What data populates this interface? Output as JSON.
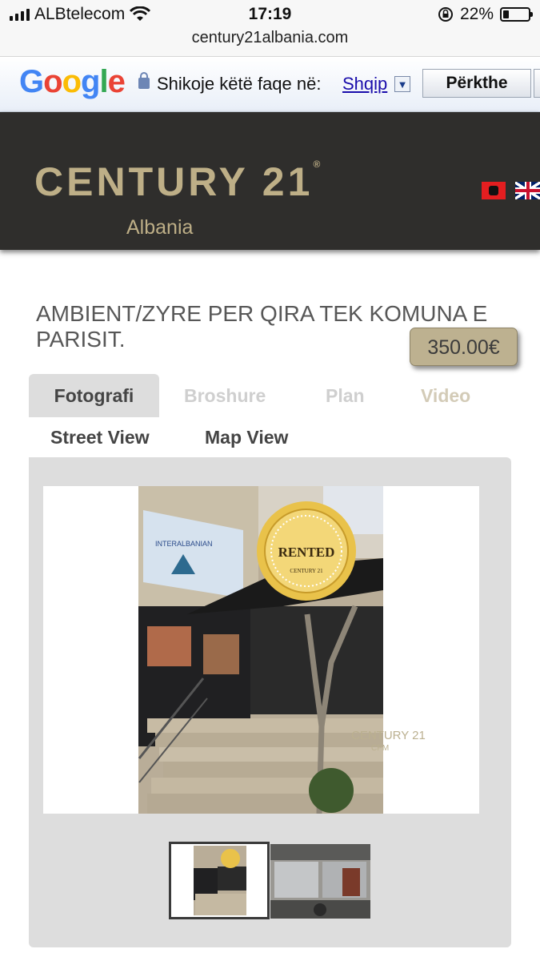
{
  "status_bar": {
    "carrier": "ALBtelecom",
    "time": "17:19",
    "battery": "22%",
    "battery_level": 0.22,
    "url": "century21albania.com"
  },
  "google_translate": {
    "logo": "Google",
    "prompt": "Shikoje këtë faqe në:",
    "language": "Shqip",
    "dropdown_glyph": "▼",
    "translate_button": "Përkthe"
  },
  "header": {
    "brand": "CENTURY 21",
    "brand_mark": "®",
    "subtitle": "Albania",
    "color": "#beaf87",
    "flags": [
      "albania-flag",
      "uk-flag"
    ]
  },
  "listing": {
    "title": "AMBIENT/ZYRE PER QIRA TEK KOMUNA E PARISIT.",
    "price": "350.00€"
  },
  "tabs": {
    "fotografi": "Fotografi",
    "broshure": "Broshure",
    "plan": "Plan",
    "video": "Video",
    "street_view": "Street View",
    "map_view": "Map View",
    "active": "Fotografi"
  },
  "photo": {
    "seal_text": "RENTED",
    "seal_subtext": "CENTURY 21",
    "watermark": "CENTURY 21",
    "watermark_sub": "CPM",
    "sign_text": "INTERALBANIAN"
  },
  "thumbnails": [
    "thumbnail-1-selected",
    "thumbnail-2"
  ]
}
